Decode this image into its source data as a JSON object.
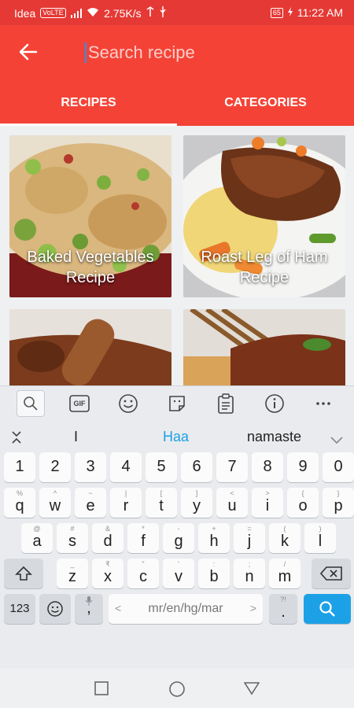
{
  "status_bar": {
    "carrier": "Idea",
    "network_badge": "VoLTE",
    "speed": "2.75K/s",
    "battery": "65",
    "time": "11:22 AM"
  },
  "app_bar": {
    "search_placeholder": "Search recipe",
    "tabs": [
      {
        "label": "RECIPES",
        "active": true
      },
      {
        "label": "CATEGORIES",
        "active": false
      }
    ]
  },
  "recipes": [
    {
      "title_line1": "Baked Vegetables",
      "title_line2": "Recipe"
    },
    {
      "title_line1": "Roast Leg of Ham",
      "title_line2": "Recipe"
    }
  ],
  "keyboard": {
    "toolbar_icons": [
      "search-icon",
      "gif-icon",
      "emoji-icon",
      "sticker-icon",
      "clipboard-icon",
      "info-icon",
      "more-icon"
    ],
    "gif_label": "GIF",
    "suggestions": [
      "I",
      "Haa",
      "namaste"
    ],
    "number_row": [
      "1",
      "2",
      "3",
      "4",
      "5",
      "6",
      "7",
      "8",
      "9",
      "0"
    ],
    "row1": [
      {
        "k": "q",
        "h": "%"
      },
      {
        "k": "w",
        "h": "^"
      },
      {
        "k": "e",
        "h": "~"
      },
      {
        "k": "r",
        "h": "|"
      },
      {
        "k": "t",
        "h": "["
      },
      {
        "k": "y",
        "h": "]"
      },
      {
        "k": "u",
        "h": "<"
      },
      {
        "k": "i",
        "h": ">"
      },
      {
        "k": "o",
        "h": "{"
      },
      {
        "k": "p",
        "h": "}"
      }
    ],
    "row2": [
      {
        "k": "a",
        "h": "@"
      },
      {
        "k": "s",
        "h": "#"
      },
      {
        "k": "d",
        "h": "&"
      },
      {
        "k": "f",
        "h": "*"
      },
      {
        "k": "g",
        "h": "-"
      },
      {
        "k": "h",
        "h": "+"
      },
      {
        "k": "j",
        "h": "="
      },
      {
        "k": "k",
        "h": "("
      },
      {
        "k": "l",
        "h": ")"
      }
    ],
    "row3": [
      {
        "k": "z",
        "h": "_"
      },
      {
        "k": "x",
        "h": "₹"
      },
      {
        "k": "c",
        "h": "\""
      },
      {
        "k": "v",
        "h": "'"
      },
      {
        "k": "b",
        "h": ":"
      },
      {
        "k": "n",
        "h": ";"
      },
      {
        "k": "m",
        "h": "/"
      }
    ],
    "symbols_label": "123",
    "comma_label": ",",
    "space_label": "mr/en/hg/mar",
    "space_left": "<",
    "space_right": ">",
    "period_label": ".",
    "period_hint": "?!"
  },
  "colors": {
    "primary": "#f44336",
    "primary_dark": "#e53935",
    "accent": "#1da1e6"
  }
}
